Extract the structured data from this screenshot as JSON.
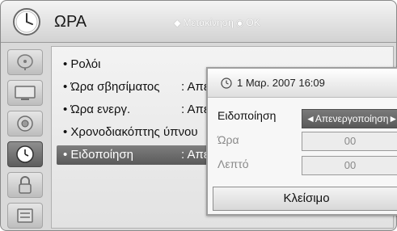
{
  "header": {
    "title": "ΩΡΑ",
    "hint_move": "Μετακίνηση",
    "hint_ok": "OK",
    "icon": "clock-icon"
  },
  "sidebar": {
    "items": [
      {
        "icon": "satellite-dish-icon",
        "active": false
      },
      {
        "icon": "monitor-icon",
        "active": false
      },
      {
        "icon": "speaker-icon",
        "active": false
      },
      {
        "icon": "clock-icon",
        "active": true
      },
      {
        "icon": "lock-icon",
        "active": false
      },
      {
        "icon": "settings-panel-icon",
        "active": false
      }
    ]
  },
  "list": {
    "items": [
      {
        "label": "• Ρολόι",
        "value": ""
      },
      {
        "label": "• Ώρα σβησίματος",
        "value": ": Απεν"
      },
      {
        "label": "• Ώρα ενεργ.",
        "value": ": Απεν"
      },
      {
        "label": "• Χρονοδιακόπτης ύπνου",
        "value": ""
      },
      {
        "label": "• Ειδοποίηση",
        "value": ": Απεν"
      }
    ],
    "selected_index": 4
  },
  "popup": {
    "datetime": "1 Μαρ. 2007 16:09",
    "fields": [
      {
        "label": "Ειδοποίηση",
        "value": "Απενεργοποίηση",
        "active": true
      },
      {
        "label": "Ώρα",
        "value": "00",
        "active": false
      },
      {
        "label": "Λεπτό",
        "value": "00",
        "active": false
      }
    ],
    "arrow_left": "◄",
    "arrow_right": "►",
    "close_label": "Κλείσιμο"
  },
  "colors": {
    "menu_bg": "#d9d9d9",
    "selected_bg": "#5d5d5d",
    "selected_text": "#ffffff"
  }
}
